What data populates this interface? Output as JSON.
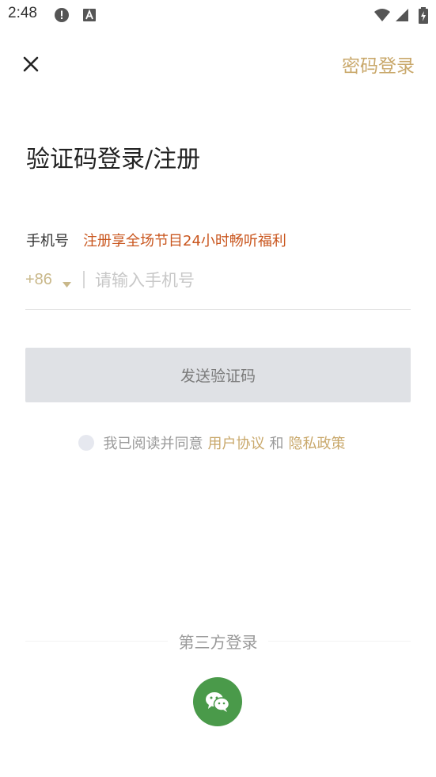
{
  "status_bar": {
    "time": "2:48",
    "icons": [
      "alert-icon",
      "keyboard-a-icon",
      "wifi-icon",
      "signal-icon",
      "battery-charging-icon"
    ]
  },
  "top_bar": {
    "close_icon": "close-icon",
    "password_login_label": "密码登录"
  },
  "title": "验证码登录/注册",
  "phone": {
    "label": "手机号",
    "promo": "注册享全场节目24小时畅听福利",
    "country_code": "+86",
    "placeholder": "请输入手机号",
    "value": ""
  },
  "send_code_label": "发送验证码",
  "agreement": {
    "prefix": "我已阅读并同意",
    "user_agreement": "用户协议",
    "and": "和",
    "privacy_policy": "隐私政策",
    "checked": false
  },
  "third_party": {
    "label": "第三方登录",
    "wechat_icon": "wechat-icon"
  },
  "colors": {
    "accent": "#c9a86b",
    "promo": "#c9561e",
    "button_bg": "#dfe1e5",
    "wechat": "#4a9a4a"
  }
}
